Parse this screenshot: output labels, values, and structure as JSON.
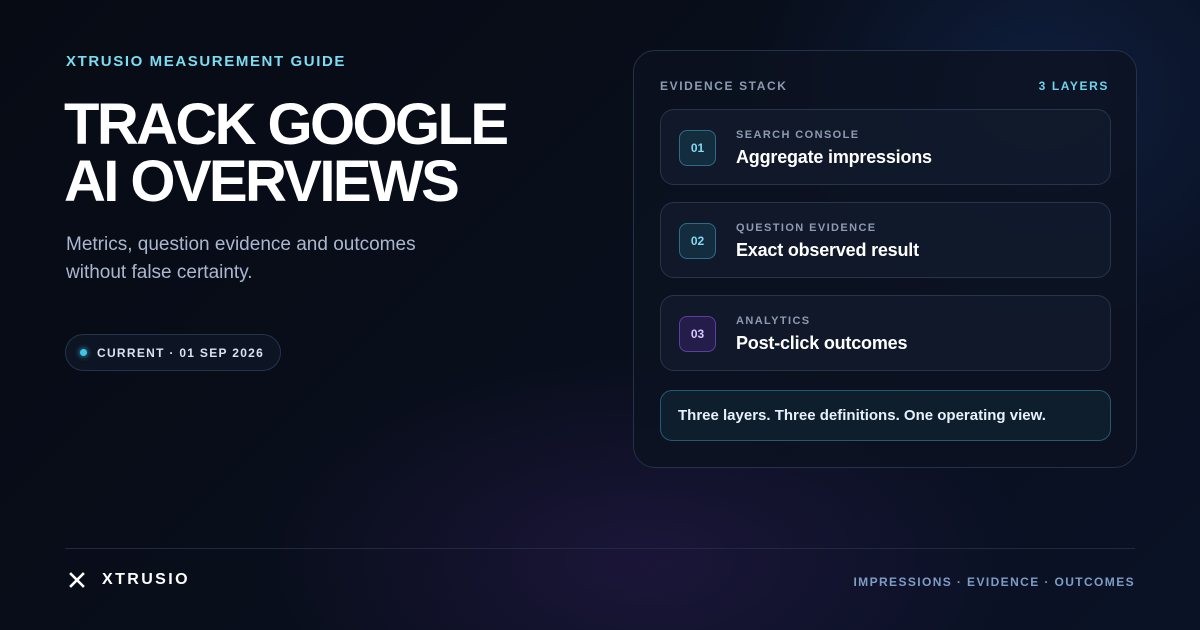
{
  "eyebrow": "XTRUSIO MEASUREMENT GUIDE",
  "headline": {
    "line1": "TRACK GOOGLE",
    "line2": "AI OVERVIEWS"
  },
  "subtext": {
    "line1": "Metrics, question evidence and outcomes",
    "line2": "without false certainty."
  },
  "status": {
    "label": "CURRENT · 01 SEP 2026",
    "dot_color": "#3fc6e8"
  },
  "panel": {
    "label": "EVIDENCE STACK",
    "count": "3 LAYERS",
    "layers": [
      {
        "number": "01",
        "kicker": "SEARCH CONSOLE",
        "title": "Aggregate impressions",
        "accent": "#84d8f0"
      },
      {
        "number": "02",
        "kicker": "QUESTION EVIDENCE",
        "title": "Exact observed result",
        "accent": "#84d8f0"
      },
      {
        "number": "03",
        "kicker": "ANALYTICS",
        "title": "Post-click outcomes",
        "accent": "#d6c8ff"
      }
    ],
    "note": "Three layers. Three definitions. One operating view."
  },
  "footer": {
    "brand_icon": "x-logo-icon",
    "brand_name": "XTRUSIO",
    "tags": "IMPRESSIONS · EVIDENCE · OUTCOMES"
  },
  "colors": {
    "accent_cyan": "#7ddcf2",
    "accent_purple": "#6a4bc4",
    "background": "#080d1a"
  }
}
